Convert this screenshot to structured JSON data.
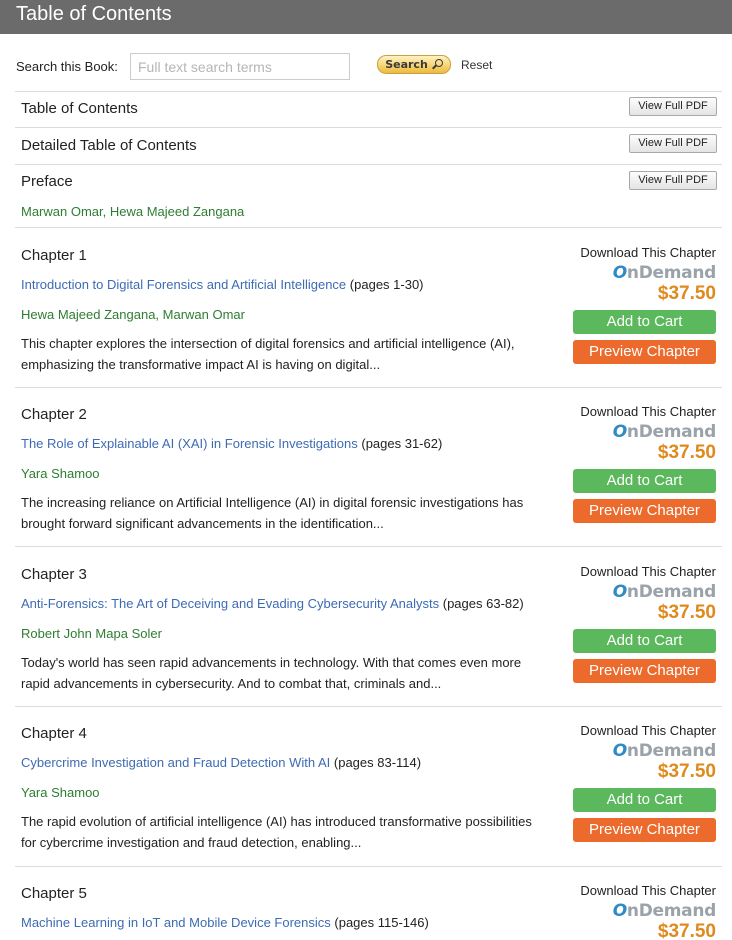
{
  "header": {
    "title": "Table of Contents"
  },
  "search": {
    "label": "Search this Book:",
    "placeholder": "Full text search terms",
    "button_label": "Search",
    "reset_label": "Reset"
  },
  "front_matter": [
    {
      "title": "Table of Contents",
      "button": "View Full PDF"
    },
    {
      "title": "Detailed Table of Contents",
      "button": "View Full PDF"
    },
    {
      "title": "Preface",
      "button": "View Full PDF",
      "authors": "Marwan Omar, Hewa Majeed Zangana"
    }
  ],
  "purchase": {
    "download_label": "Download This Chapter",
    "ondemand_o": "O",
    "ondemand_rest": "nDemand",
    "add_to_cart": "Add to Cart",
    "preview": "Preview Chapter"
  },
  "chapters": [
    {
      "number": "Chapter 1",
      "title": "Introduction to Digital Forensics and Artificial Intelligence",
      "pages": "(pages 1-30)",
      "authors": "Hewa Majeed Zangana, Marwan Omar",
      "abstract": "This chapter explores the intersection of digital forensics and artificial intelligence (AI), emphasizing the transformative impact AI is having on digital...",
      "price": "$37.50"
    },
    {
      "number": "Chapter 2",
      "title": "The Role of Explainable AI (XAI) in Forensic Investigations",
      "pages": "(pages 31-62)",
      "authors": "Yara Shamoo",
      "abstract": "The increasing reliance on Artificial Intelligence (AI) in digital forensic investigations has brought forward significant advancements in the identification...",
      "price": "$37.50"
    },
    {
      "number": "Chapter 3",
      "title": "Anti-Forensics: The Art of Deceiving and Evading Cybersecurity Analysts",
      "pages": "(pages 63-82)",
      "authors": "Robert John Mapa Soler",
      "abstract": "Today's world has seen rapid advancements in technology. With that comes even more rapid advancements in cybersecurity. And to combat that, criminals and...",
      "price": "$37.50"
    },
    {
      "number": "Chapter 4",
      "title": "Cybercrime Investigation and Fraud Detection With AI",
      "pages": "(pages 83-114)",
      "authors": "Yara Shamoo",
      "abstract": "The rapid evolution of artificial intelligence (AI) has introduced transformative possibilities for cybercrime investigation and fraud detection, enabling...",
      "price": "$37.50"
    },
    {
      "number": "Chapter 5",
      "title": "Machine Learning in IoT and Mobile Device Forensics",
      "pages": "(pages 115-146)",
      "authors": "",
      "abstract": "",
      "price": "$37.50"
    }
  ]
}
